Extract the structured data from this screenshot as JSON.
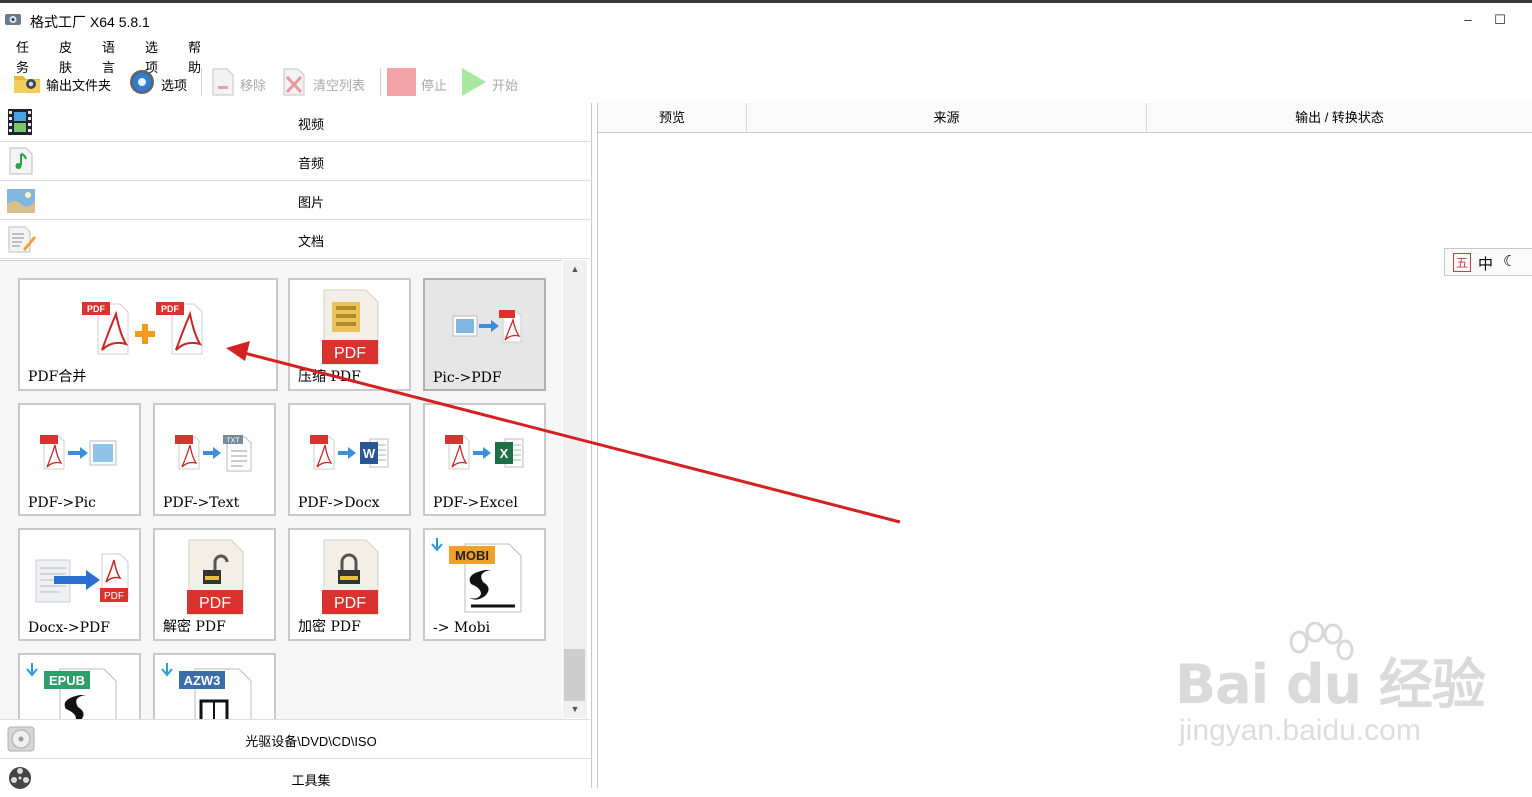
{
  "window": {
    "title": "格式工厂 X64 5.8.1",
    "minimize": "–",
    "maximize": "☐",
    "close": "✕"
  },
  "menu": [
    "任务",
    "皮肤",
    "语言",
    "选项",
    "帮助"
  ],
  "toolbar": {
    "output_folder": "输出文件夹",
    "options": "选项",
    "remove": "移除",
    "clear_list": "清空列表",
    "stop": "停止",
    "start": "开始"
  },
  "categories": {
    "video": "视频",
    "audio": "音频",
    "picture": "图片",
    "document": "文档",
    "disc": "光驱设备\\DVD\\CD\\ISO",
    "tools": "工具集"
  },
  "tiles": {
    "pdf_merge": "PDF合并",
    "compress_pdf": "压缩 PDF",
    "pic_to_pdf": "Pic->PDF",
    "pdf_to_pic": "PDF->Pic",
    "pdf_to_text": "PDF->Text",
    "pdf_to_docx": "PDF->Docx",
    "pdf_to_excel": "PDF->Excel",
    "docx_to_pdf": "Docx->PDF",
    "decrypt_pdf": "解密 PDF",
    "encrypt_pdf": "加密 PDF",
    "to_mobi": "-> Mobi"
  },
  "badges": {
    "pdf": "PDF",
    "txt": "TXT",
    "word": "W",
    "excel": "X",
    "mobi": "MOBI",
    "epub": "EPUB",
    "azw3": "AZW3"
  },
  "table_headers": [
    "预览",
    "来源",
    "输出 / 转换状态"
  ],
  "ime": [
    "五",
    "中"
  ],
  "watermark": {
    "brand": "Bai du 经验",
    "url": "jingyan.baidu.com"
  },
  "colors": {
    "pdf_red": "#d9322f",
    "arrow_red": "#d42020",
    "mobi_orange": "#f0a02a",
    "epub_green": "#2e9e6a",
    "azw3_blue": "#3a6ea8"
  }
}
